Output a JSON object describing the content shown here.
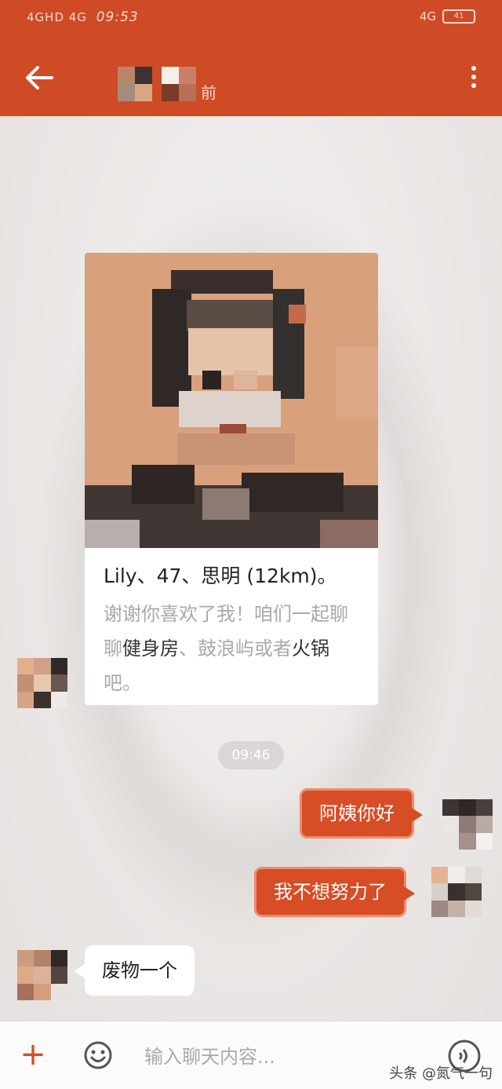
{
  "status_bar": {
    "network": "4GHD 4G",
    "time": "09:53",
    "right_network": "4G",
    "battery": "41"
  },
  "header": {
    "title_suffix": "前"
  },
  "profile_card": {
    "title": "Lily、47、思明 (12km)。",
    "desc_part1": "谢谢你喜欢了我！咱们一起聊聊",
    "desc_hl1": "健身房",
    "desc_part2": "、鼓浪屿或者",
    "desc_hl2": "火锅",
    "desc_part3": "吧。"
  },
  "timestamp": "09:46",
  "messages": [
    {
      "side": "out",
      "text": "阿姨你好"
    },
    {
      "side": "out",
      "text": "我不想努力了"
    },
    {
      "side": "in",
      "text": "废物一个"
    }
  ],
  "input": {
    "placeholder": "输入聊天内容..."
  },
  "watermark": "头条 @氮气一句",
  "colors": {
    "header": "#cf4b25",
    "bubble_out": "#d64d26",
    "bubble_in": "#ffffff"
  }
}
